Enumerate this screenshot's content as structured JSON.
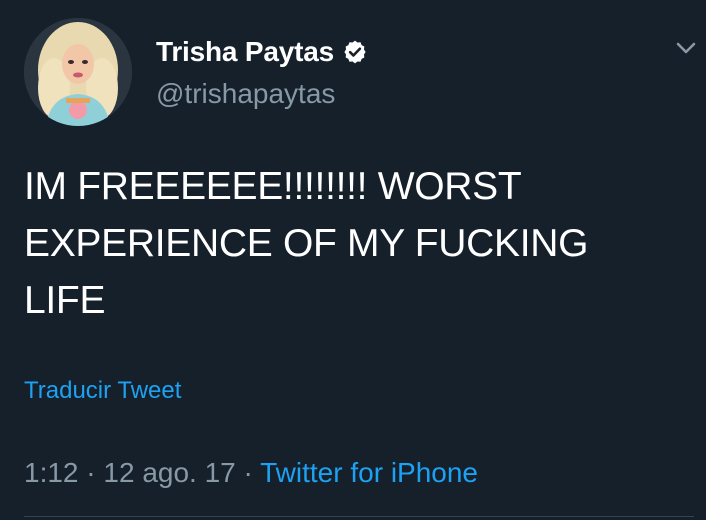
{
  "author": {
    "display_name": "Trisha Paytas",
    "handle": "@trishapaytas",
    "verified": true
  },
  "tweet": {
    "text": "IM FREEEEEE!!!!!!!! WORST EXPERIENCE OF MY FUCKING LIFE",
    "translate_label": "Traducir Tweet",
    "time": "1:12",
    "separator": "·",
    "date": "12 ago. 17",
    "source": "Twitter for iPhone"
  },
  "icons": {
    "verified": "verified-badge-icon",
    "more": "chevron-down-icon"
  },
  "colors": {
    "background": "#15202b",
    "text_primary": "#ffffff",
    "text_secondary": "#8899a6",
    "accent": "#1da1f2"
  }
}
